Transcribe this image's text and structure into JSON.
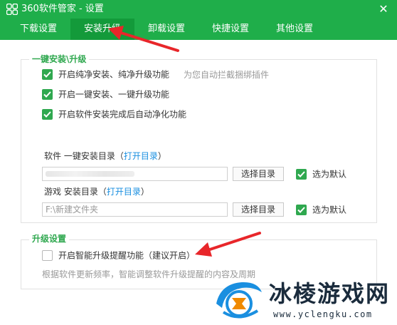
{
  "window": {
    "title": "360软件管家 - 设置",
    "close_symbol": "✕"
  },
  "tabs": [
    {
      "label": "下载设置",
      "active": false
    },
    {
      "label": "安装升级",
      "active": true
    },
    {
      "label": "卸载设置",
      "active": false
    },
    {
      "label": "快捷设置",
      "active": false
    },
    {
      "label": "其他设置",
      "active": false
    }
  ],
  "install_group": {
    "title": "一键安装\\升级",
    "options": [
      {
        "label": "开启纯净安装、纯净升级功能",
        "checked": true,
        "hint": "为您自动拦截捆绑插件"
      },
      {
        "label": "开启一键安装、一键升级功能",
        "checked": true
      },
      {
        "label": "开启软件安装完成后自动净化功能",
        "checked": true
      }
    ],
    "software_dir": {
      "label": "软件 一键安装目录",
      "paren_open": "（",
      "link": "打开目录",
      "paren_close": "）",
      "path": "",
      "button": "选择目录",
      "default_label": "选为默认",
      "default_checked": true
    },
    "game_dir": {
      "label": "游戏 安装目录",
      "paren_open": "（",
      "link": "打开目录",
      "paren_close": "）",
      "path": "F:\\新建文件夹",
      "button": "选择目录",
      "default_label": "选为默认",
      "default_checked": true
    }
  },
  "upgrade_group": {
    "title": "升级设置",
    "option": {
      "label": "开启智能升级提醒功能（建议开启）",
      "checked": false
    },
    "description": "根据软件更新频率，智能调整软件升级提醒的内容及周期"
  },
  "watermark": {
    "name": "冰棱游戏网",
    "url": "www.yclengku.com"
  },
  "colors": {
    "brand_green": "#1fae4a",
    "active_tab": "#139a3a",
    "checkbox_green": "#2fa84f",
    "link_blue": "#1a8fe0",
    "annotation_red": "#e8262a"
  }
}
